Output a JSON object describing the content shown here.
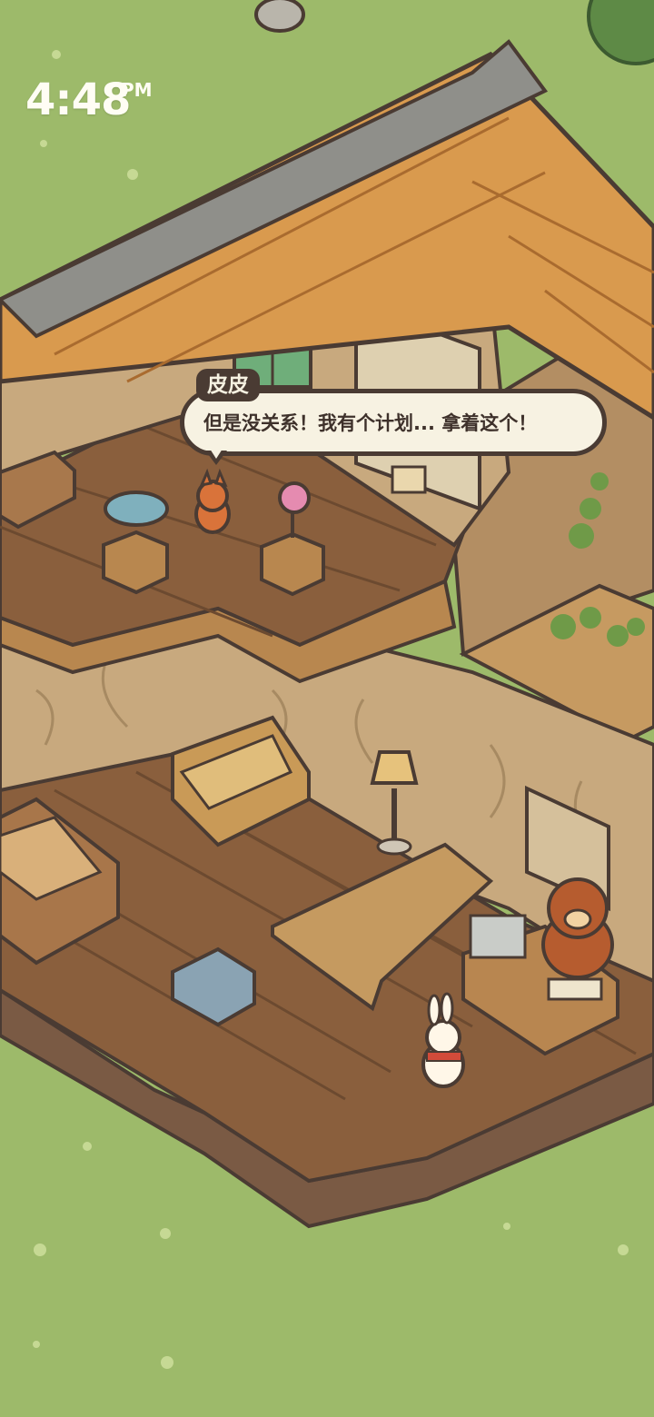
{
  "status_bar": {
    "time": "4:48",
    "ampm": "PM"
  },
  "dialogue": {
    "speaker": "皮皮",
    "text": "但是没关系！我有个计划... 拿着这个！"
  },
  "colors": {
    "grass": "#9dba6a",
    "roof_tile": "#d99a4e",
    "floor_wood": "#8a5f3d",
    "wall": "#c8a97e",
    "outline": "#4a3b33",
    "bubble_bg": "#f7f2e2"
  }
}
